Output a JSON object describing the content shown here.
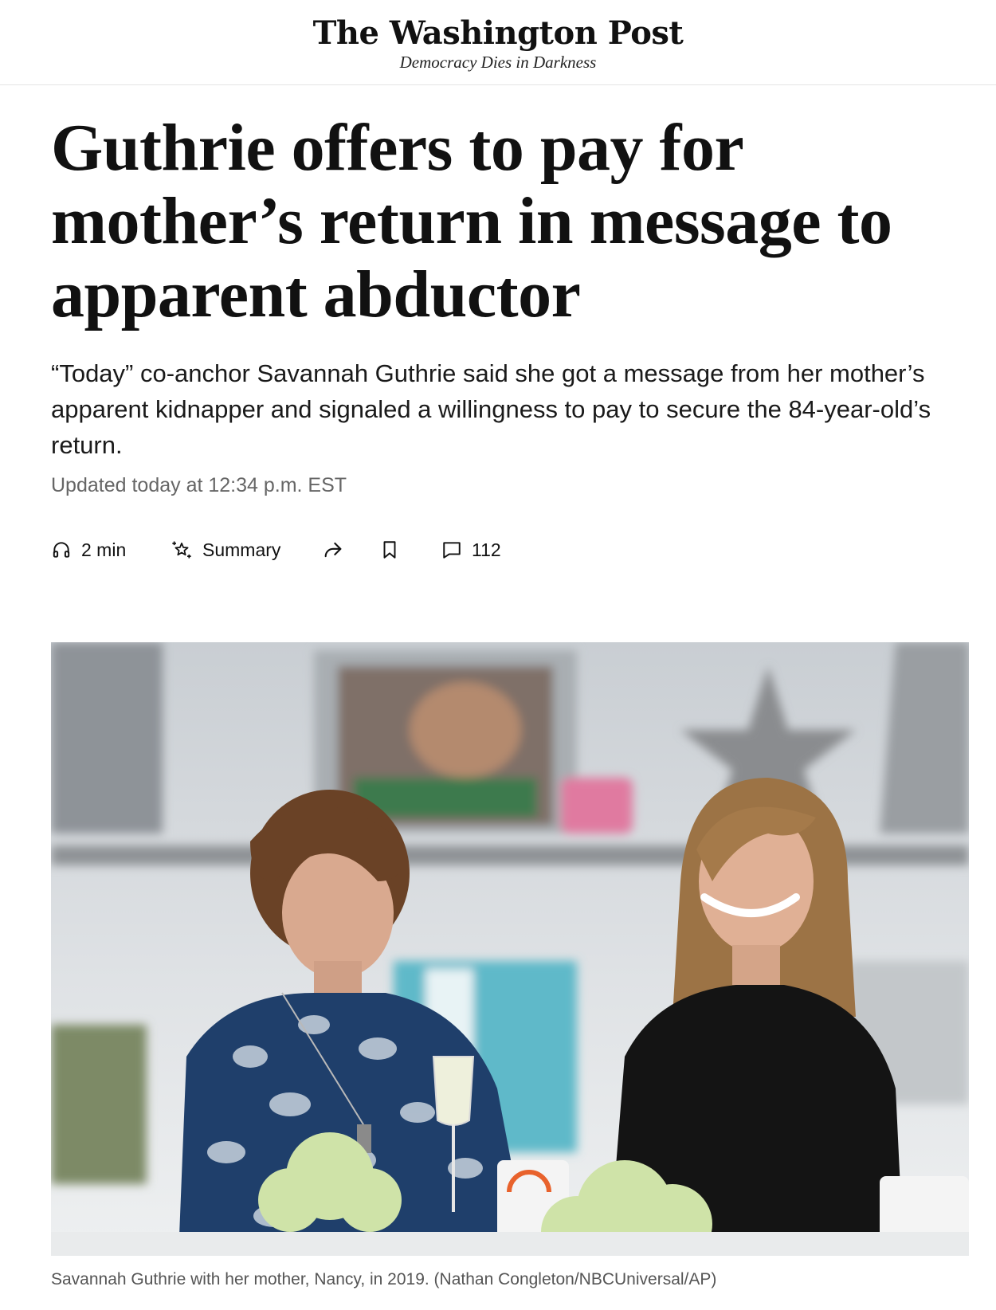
{
  "masthead": {
    "logo": "The Washington Post",
    "tagline": "Democracy Dies in Darkness"
  },
  "article": {
    "headline": "Guthrie offers to pay for mother’s return in message to apparent abductor",
    "dek": "“Today” co-anchor Savannah Guthrie said she got a message from her mother’s apparent kidnapper and signaled a willingness to pay to secure the 84-year-old’s return.",
    "timestamp": "Updated today at 12:34 p.m. EST"
  },
  "toolbar": {
    "listen_label": "2 min",
    "summary_label": "Summary",
    "comments_count": "112"
  },
  "photo": {
    "caption": "Savannah Guthrie with her mother, Nancy, in 2019. (Nathan Congleton/NBCUniversal/AP)"
  },
  "colors": {
    "text": "#111111",
    "muted": "#666666",
    "caption": "#555555"
  }
}
